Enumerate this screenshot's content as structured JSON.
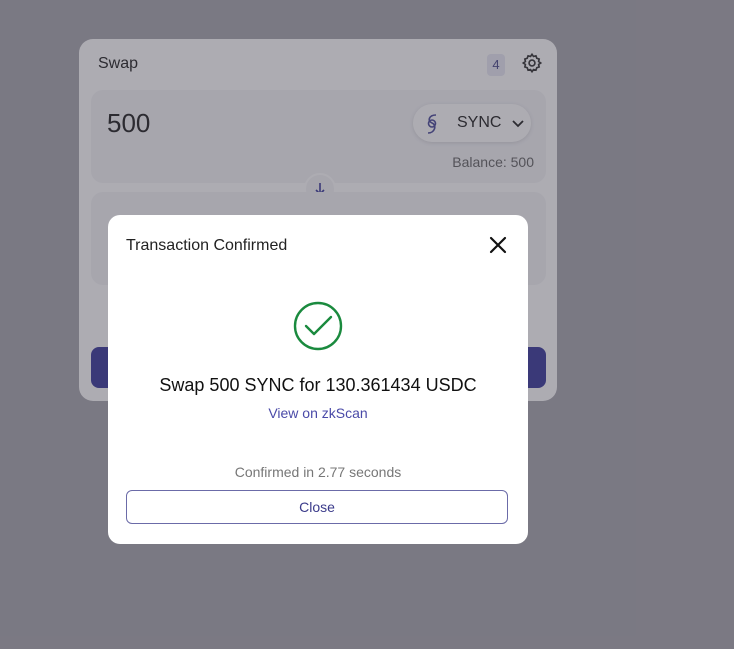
{
  "swap": {
    "title": "Swap",
    "badge_count": "4",
    "amount": "500",
    "token": "SYNC",
    "balance": "Balance: 500"
  },
  "modal": {
    "title": "Transaction Confirmed",
    "summary": "Swap 500 SYNC for 130.361434 USDC",
    "explorer_link": "View on zkScan",
    "confirmed_time": "Confirmed in 2.77 seconds",
    "close_label": "Close"
  },
  "icons": {
    "settings": "gear-icon",
    "token": "sync-token-icon",
    "chevron": "chevron-down-icon",
    "switch": "arrow-down-icon",
    "close": "close-icon",
    "success": "check-circle-icon"
  },
  "colors": {
    "accent": "#3a3a9c",
    "success": "#1a8a3e",
    "link": "#4a4aa8"
  }
}
